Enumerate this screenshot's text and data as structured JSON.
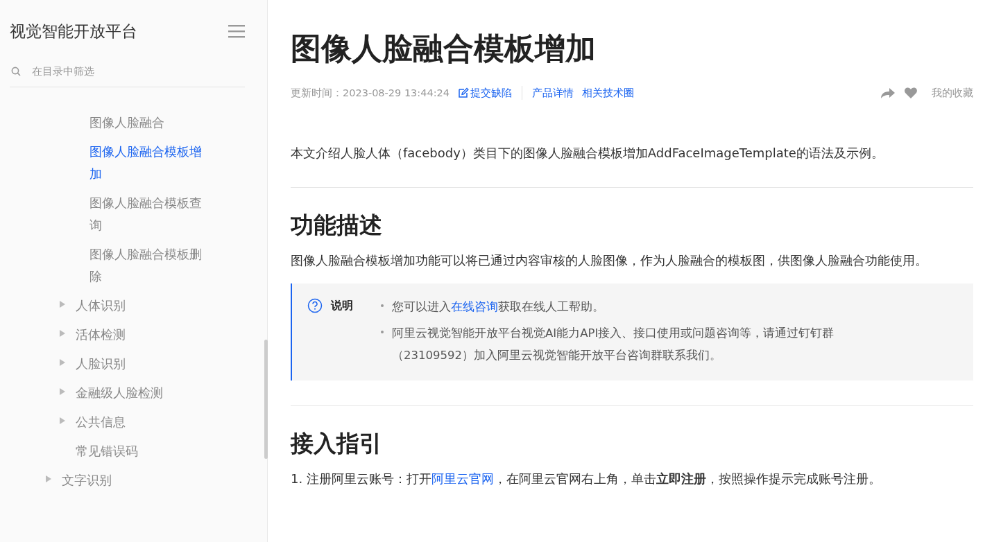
{
  "sidebar": {
    "title": "视觉智能开放平台",
    "search": {
      "placeholder": "在目录中筛选"
    },
    "tree": [
      {
        "children": [
          {
            "children": [
              {
                "label": "图像人脸融合",
                "selected": false
              },
              {
                "label": "图像人脸融合模板增加",
                "selected": true
              },
              {
                "label": "图像人脸融合模板查询",
                "selected": false
              },
              {
                "label": "图像人脸融合模板删除",
                "selected": false
              }
            ]
          },
          {
            "label": "人体识别",
            "selected": false,
            "expanded": false
          },
          {
            "label": "活体检测",
            "selected": false,
            "expanded": false
          },
          {
            "label": "人脸识别",
            "selected": false,
            "expanded": false
          },
          {
            "label": "金融级人脸检测",
            "selected": false,
            "expanded": false
          },
          {
            "label": "公共信息",
            "selected": false,
            "expanded": false
          },
          {
            "label": "常见错误码",
            "selected": false
          }
        ]
      },
      {
        "label": "文字识别",
        "selected": false,
        "expanded": false
      }
    ]
  },
  "article": {
    "title": "图像人脸融合模板增加",
    "meta": {
      "updated": "更新时间：2023-08-29 13:44:24",
      "report": "提交缺陷",
      "links": [
        "产品详情",
        "相关技术圈"
      ],
      "favorite": "我的收藏"
    },
    "intro": "本文介绍人脸人体（facebody）类目下的图像人脸融合模板增加AddFaceImageTemplate的语法及示例。",
    "sections": [
      {
        "heading": "功能描述",
        "paragraph": "图像人脸融合模板增加功能可以将已通过内容审核的人脸图像，作为人脸融合的模板图，供图像人脸融合功能使用。",
        "note": {
          "label": "说明",
          "items": [
            {
              "parts": [
                {
                  "text": "您可以进入"
                },
                {
                  "text": "在线咨询",
                  "link": true
                },
                {
                  "text": "获取在线人工帮助。"
                }
              ]
            },
            {
              "parts": [
                {
                  "text": "阿里云视觉智能开放平台视觉AI能力API接入、接口使用或问题咨询等，请通过钉钉群（23109592）加入阿里云视觉智能开放平台咨询群联系我们。"
                }
              ]
            }
          ]
        }
      },
      {
        "heading": "接入指引",
        "steps": [
          {
            "parts": [
              {
                "text": "1. 注册阿里云账号：打开"
              },
              {
                "text": "阿里云官网",
                "link": true
              },
              {
                "text": "，在阿里云官网右上角，单击**立即注册**，按照操作提示完成账号注册。"
              }
            ]
          }
        ]
      }
    ]
  }
}
